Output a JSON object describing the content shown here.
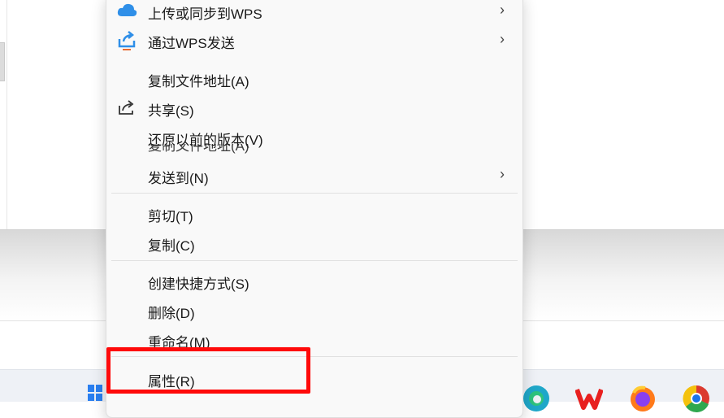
{
  "menu": {
    "items": [
      {
        "label": "上传或同步到WPS",
        "icon": "cloud-icon",
        "submenu": true
      },
      {
        "label": "通过WPS发送",
        "icon": "send-share-icon",
        "submenu": true
      },
      {
        "label": "复制文件地址(A)"
      },
      {
        "label": "共享(S)",
        "icon": "share-icon"
      },
      {
        "label": "还原以前的版本(V)"
      },
      {
        "label": "发送到(N)",
        "submenu": true
      },
      {
        "label": "剪切(T)"
      },
      {
        "label": "复制(C)"
      },
      {
        "label": "创建快捷方式(S)"
      },
      {
        "label": "删除(D)"
      },
      {
        "label": "重命名(M)"
      },
      {
        "label": "属性(R)"
      }
    ],
    "overlap_ghost_text": "复制文件地址(A)",
    "submenu_arrow": "›"
  },
  "highlight_color": "#ff0a0a",
  "taskbar": {
    "icons": [
      "windows-start-icon",
      "edge-browser-icon",
      "wps-office-icon",
      "firefox-icon",
      "chrome-icon"
    ]
  }
}
